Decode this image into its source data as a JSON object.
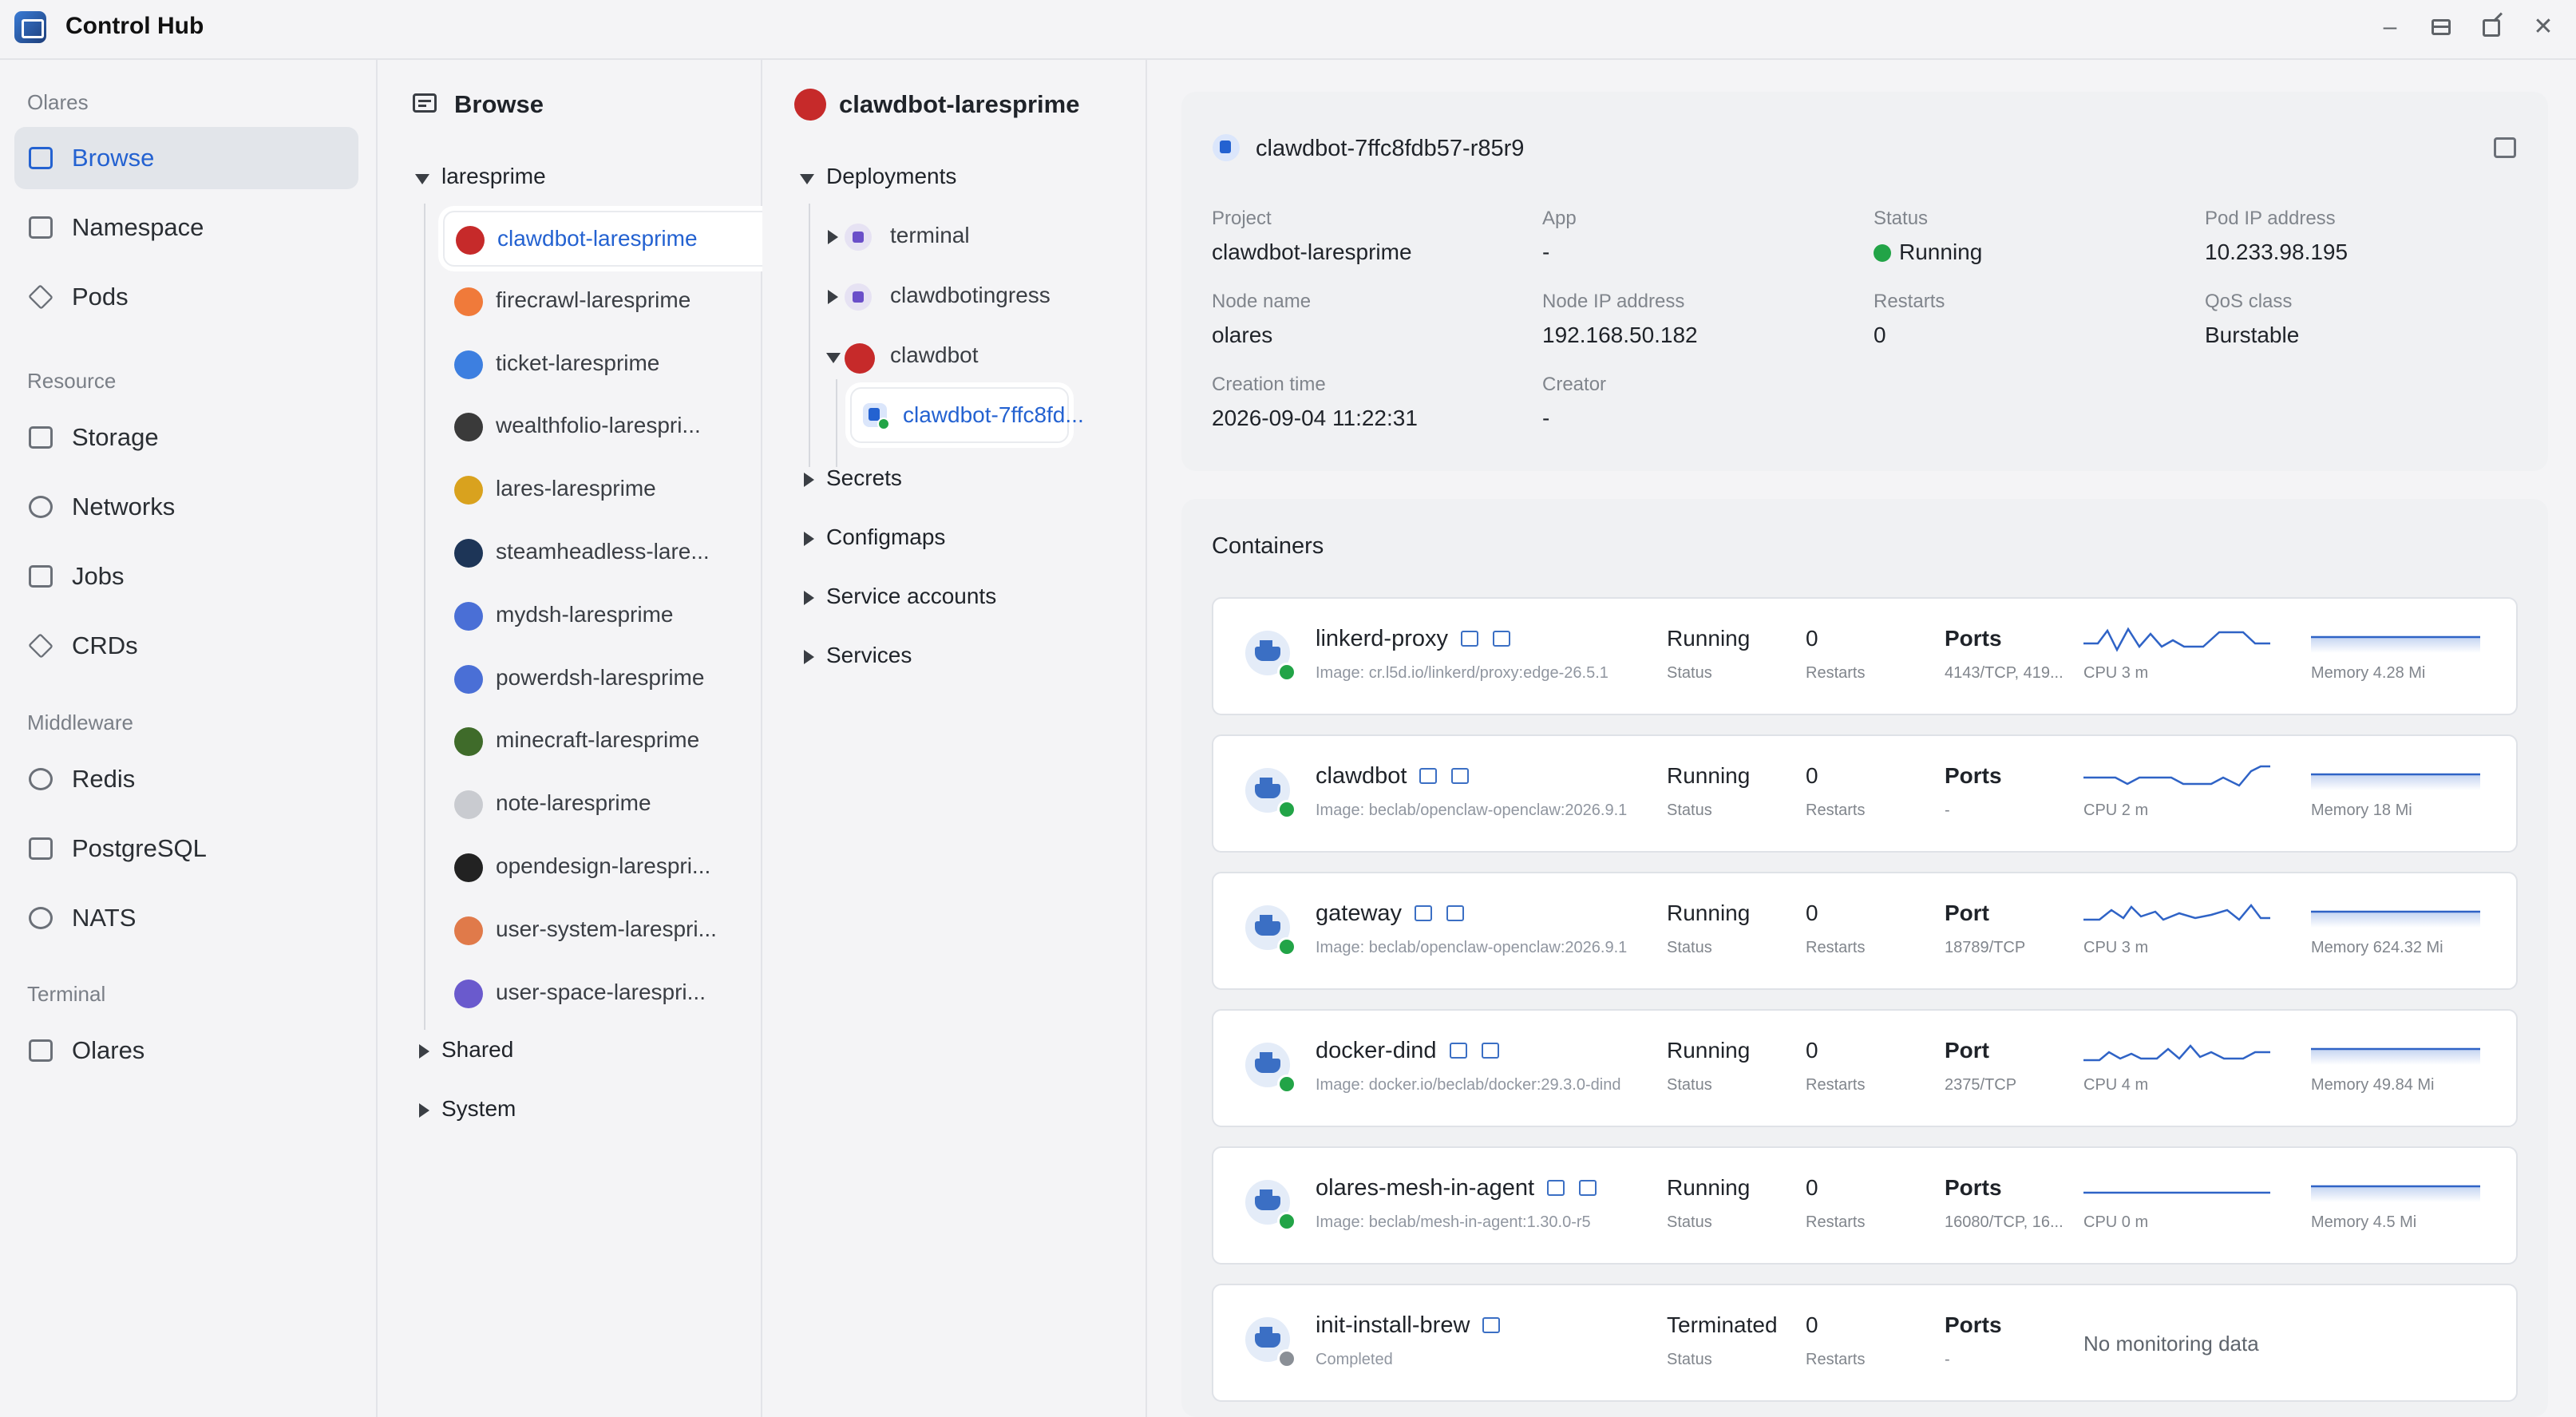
{
  "app": {
    "title": "Control Hub"
  },
  "nav": {
    "sections": [
      {
        "label": "Olares",
        "items": [
          {
            "label": "Browse",
            "icon": "browse-icon",
            "active": true
          },
          {
            "label": "Namespace",
            "icon": "namespace-icon"
          },
          {
            "label": "Pods",
            "icon": "pods-icon"
          }
        ]
      },
      {
        "label": "Resource",
        "items": [
          {
            "label": "Storage",
            "icon": "storage-icon"
          },
          {
            "label": "Networks",
            "icon": "networks-icon"
          },
          {
            "label": "Jobs",
            "icon": "jobs-icon"
          },
          {
            "label": "CRDs",
            "icon": "crds-icon"
          }
        ]
      },
      {
        "label": "Middleware",
        "items": [
          {
            "label": "Redis",
            "icon": "redis-icon"
          },
          {
            "label": "PostgreSQL",
            "icon": "postgresql-icon"
          },
          {
            "label": "NATS",
            "icon": "nats-icon"
          }
        ]
      },
      {
        "label": "Terminal",
        "items": [
          {
            "label": "Olares",
            "icon": "terminal-icon"
          }
        ]
      }
    ]
  },
  "browse": {
    "title": "Browse",
    "group": "laresprime",
    "items": [
      {
        "label": "clawdbot-laresprime",
        "color": "#c62a2a",
        "selected": true
      },
      {
        "label": "firecrawl-laresprime",
        "color": "#f07a3a"
      },
      {
        "label": "ticket-laresprime",
        "color": "#3d7fe0"
      },
      {
        "label": "wealthfolio-larespri...",
        "color": "#3a3a3a"
      },
      {
        "label": "lares-laresprime",
        "color": "#d9a21e"
      },
      {
        "label": "steamheadless-lare...",
        "color": "#1d3557"
      },
      {
        "label": "mydsh-laresprime",
        "color": "#4a6fd6"
      },
      {
        "label": "powerdsh-laresprime",
        "color": "#4a6fd6"
      },
      {
        "label": "minecraft-laresprime",
        "color": "#3f6b2a"
      },
      {
        "label": "note-laresprime",
        "color": "#c9cbd0"
      },
      {
        "label": "opendesign-larespri...",
        "color": "#222222"
      },
      {
        "label": "user-system-larespri...",
        "color": "#e07a4a"
      },
      {
        "label": "user-space-larespri...",
        "color": "#6a5acd"
      }
    ],
    "collapsed_groups": [
      "Shared",
      "System"
    ]
  },
  "resources": {
    "title": "clawdbot-laresprime",
    "deployments_label": "Deployments",
    "deployments": [
      {
        "label": "terminal"
      },
      {
        "label": "clawdbotingress"
      },
      {
        "label": "clawdbot"
      }
    ],
    "pod": "clawdbot-7ffc8fd...",
    "groups": [
      "Secrets",
      "Configmaps",
      "Service accounts",
      "Services"
    ]
  },
  "pod": {
    "name": "clawdbot-7ffc8fdb57-r85r9",
    "fields": {
      "project": {
        "label": "Project",
        "value": "clawdbot-laresprime"
      },
      "app": {
        "label": "App",
        "value": "-"
      },
      "status": {
        "label": "Status",
        "value": "Running"
      },
      "pod_ip": {
        "label": "Pod IP address",
        "value": "10.233.98.195"
      },
      "node_name": {
        "label": "Node name",
        "value": "olares"
      },
      "node_ip": {
        "label": "Node IP address",
        "value": "192.168.50.182"
      },
      "restarts": {
        "label": "Restarts",
        "value": "0"
      },
      "qos": {
        "label": "QoS class",
        "value": "Burstable"
      },
      "creation": {
        "label": "Creation time",
        "value": "2026-09-04 11:22:31"
      },
      "creator": {
        "label": "Creator",
        "value": "-"
      }
    }
  },
  "containers": {
    "title": "Containers",
    "status_label": "Status",
    "restarts_label": "Restarts",
    "no_monitoring": "No monitoring data",
    "items": [
      {
        "name": "linkerd-proxy",
        "image": "Image: cr.l5d.io/linkerd/proxy:edge-26.5.1",
        "status": "Running",
        "restarts": "0",
        "ports_label": "Ports",
        "ports": "4143/TCP, 419...",
        "cpu": "CPU 3 m",
        "memory": "Memory 4.28 Mi",
        "terminal": true
      },
      {
        "name": "clawdbot",
        "image": "Image: beclab/openclaw-openclaw:2026.9.1",
        "status": "Running",
        "restarts": "0",
        "ports_label": "Ports",
        "ports": "-",
        "cpu": "CPU 2 m",
        "memory": "Memory 18 Mi",
        "terminal": true
      },
      {
        "name": "gateway",
        "image": "Image: beclab/openclaw-openclaw:2026.9.1",
        "status": "Running",
        "restarts": "0",
        "ports_label": "Port",
        "ports": "18789/TCP",
        "cpu": "CPU 3 m",
        "memory": "Memory 624.32 Mi",
        "terminal": true
      },
      {
        "name": "docker-dind",
        "image": "Image: docker.io/beclab/docker:29.3.0-dind",
        "status": "Running",
        "restarts": "0",
        "ports_label": "Port",
        "ports": "2375/TCP",
        "cpu": "CPU 4 m",
        "memory": "Memory 49.84 Mi",
        "terminal": true
      },
      {
        "name": "olares-mesh-in-agent",
        "image": "Image: beclab/mesh-in-agent:1.30.0-r5",
        "status": "Running",
        "restarts": "0",
        "ports_label": "Ports",
        "ports": "16080/TCP, 16...",
        "cpu": "CPU 0 m",
        "memory": "Memory 4.5 Mi",
        "terminal": true
      },
      {
        "name": "init-install-brew",
        "image": "Completed",
        "status": "Terminated",
        "restarts": "0",
        "ports_label": "Ports",
        "ports": "-",
        "cpu": "",
        "memory": "",
        "terminal": false
      }
    ]
  },
  "colors": {
    "accent": "#2462d1",
    "running": "#22a447",
    "terminated": "#8a8f96"
  }
}
